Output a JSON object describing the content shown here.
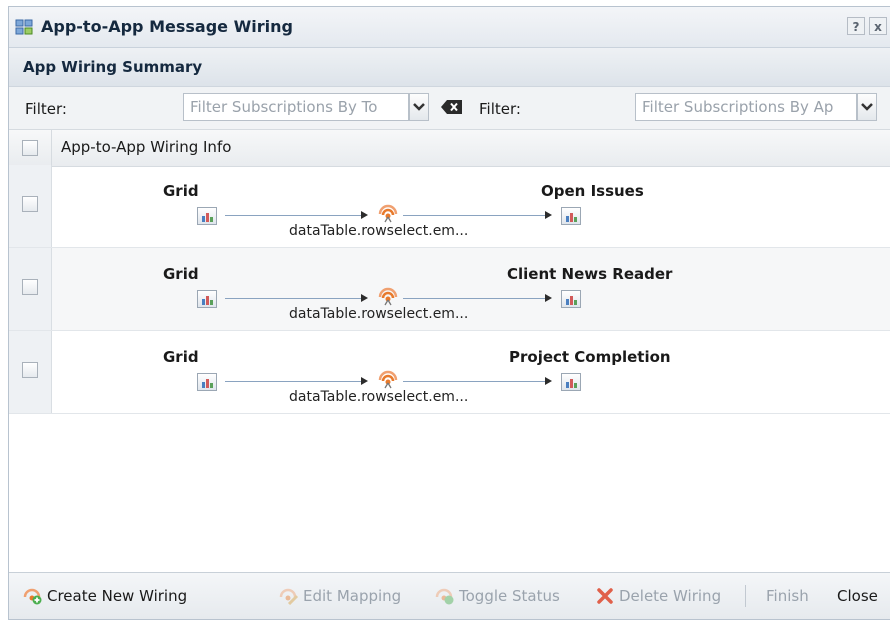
{
  "window": {
    "title": "App-to-App Message Wiring",
    "help_label": "?",
    "close_label": "x"
  },
  "summary": {
    "title": "App Wiring Summary"
  },
  "filters": {
    "topic_label": "Filter:",
    "topic_placeholder": "Filter Subscriptions By To",
    "app_label": "Filter:",
    "app_placeholder": "Filter Subscriptions By Ap"
  },
  "table": {
    "header": "App-to-App Wiring Info",
    "rows": [
      {
        "source": "Grid",
        "target": "Open Issues",
        "topic": "dataTable.rowselect.em..."
      },
      {
        "source": "Grid",
        "target": "Client News Reader",
        "topic": "dataTable.rowselect.em..."
      },
      {
        "source": "Grid",
        "target": "Project Completion",
        "topic": "dataTable.rowselect.em..."
      }
    ]
  },
  "footer": {
    "create": "Create New Wiring",
    "edit": "Edit Mapping",
    "toggle": "Toggle Status",
    "delete": "Delete Wiring",
    "finish": "Finish",
    "close": "Close"
  },
  "colors": {
    "accent": "#e87a2c",
    "delete": "#d9412a",
    "wire": "#8aa3c0",
    "header_text": "#15293f"
  }
}
